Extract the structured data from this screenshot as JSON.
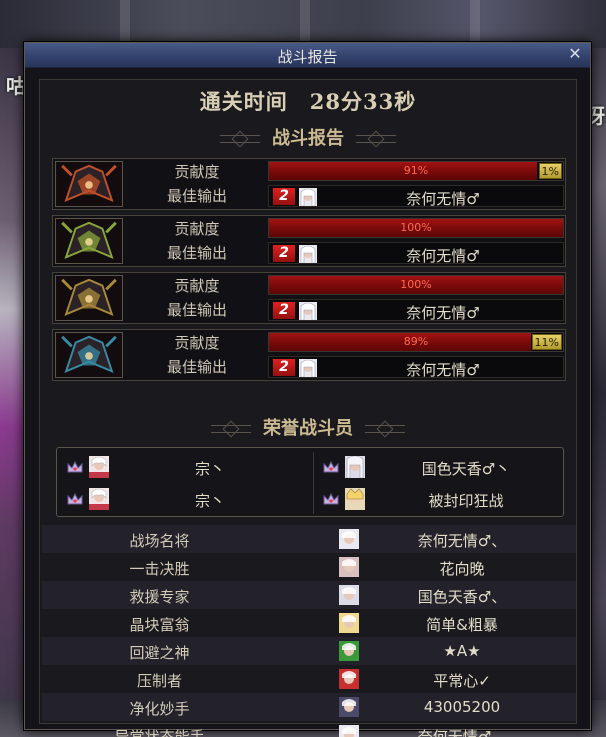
{
  "window": {
    "title": "战斗报告",
    "close_icon": "close-icon"
  },
  "clear_time": {
    "label": "通关时间",
    "value": "28分33秒"
  },
  "battle_report": {
    "heading": "战斗报告",
    "contribution_label": "贡献度",
    "best_output_label": "最佳输出",
    "bosses": [
      {
        "portrait": "red-masked-boss-portrait",
        "accent": "#c0502a",
        "contribution_pct": "91%",
        "contribution_fraction": 0.91,
        "extra_tag": "1%",
        "rank_badge": "2",
        "player": "奈何无情♂"
      },
      {
        "portrait": "green-masked-boss-portrait",
        "accent": "#8aa53a",
        "contribution_pct": "100%",
        "contribution_fraction": 1.0,
        "extra_tag": "",
        "rank_badge": "2",
        "player": "奈何无情♂"
      },
      {
        "portrait": "gold-masked-boss-portrait",
        "accent": "#a8893a",
        "contribution_pct": "100%",
        "contribution_fraction": 1.0,
        "extra_tag": "",
        "rank_badge": "2",
        "player": "奈何无情♂"
      },
      {
        "portrait": "blue-masked-boss-portrait",
        "accent": "#3a8aa5",
        "contribution_pct": "89%",
        "contribution_fraction": 0.89,
        "extra_tag": "11%",
        "rank_badge": "2",
        "player": "奈何无情♂"
      }
    ]
  },
  "honor_fighters": {
    "heading": "荣誉战斗员",
    "members": [
      {
        "crown": "crown-icon",
        "name": "宗丶"
      },
      {
        "crown": "crown-icon",
        "name": "国色天香♂丶"
      },
      {
        "crown": "crown-icon",
        "name": "宗丶"
      },
      {
        "crown": "crown-icon",
        "name": "被封印狂战"
      }
    ]
  },
  "awards": [
    {
      "title": "战场名将",
      "winner": "奈何无情♂、"
    },
    {
      "title": "一击决胜",
      "winner": "花向晚"
    },
    {
      "title": "救援专家",
      "winner": "国色天香♂、"
    },
    {
      "title": "晶块富翁",
      "winner": "简单&粗暴"
    },
    {
      "title": "回避之神",
      "winner": "★A★"
    },
    {
      "title": "压制者",
      "winner": "平常心✓"
    },
    {
      "title": "净化妙手",
      "winner": "43005200"
    },
    {
      "title": "异常状态能手",
      "winner": "奈何无情♂、"
    }
  ],
  "background": {
    "deco_left": "咕",
    "deco_right": "呀"
  },
  "colors": {
    "titlebar": "#34436e",
    "bar_fill": "#8b0d0d",
    "tag_gold": "#d4bd4d",
    "rank_badge_red": "#c81818"
  }
}
